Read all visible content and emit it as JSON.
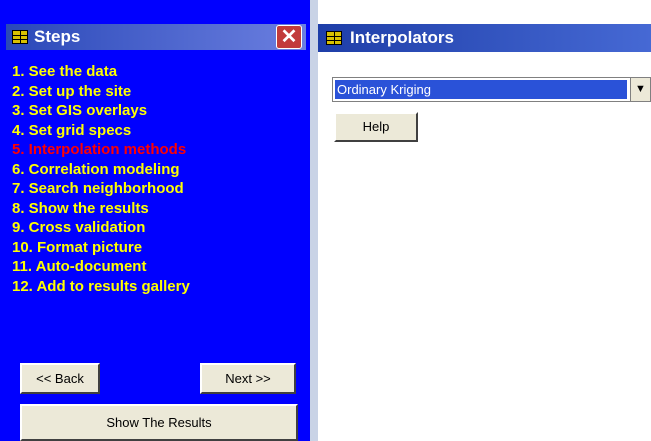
{
  "steps_panel": {
    "title": "Steps",
    "close_label": "✕",
    "items": [
      {
        "label": "1.  See the data",
        "active": false
      },
      {
        "label": "2.  Set up the site",
        "active": false
      },
      {
        "label": "3.  Set GIS overlays",
        "active": false
      },
      {
        "label": "4.  Set grid specs",
        "active": false
      },
      {
        "label": "5.  Interpolation methods",
        "active": true
      },
      {
        "label": "6.  Correlation modeling",
        "active": false
      },
      {
        "label": "7.  Search neighborhood",
        "active": false
      },
      {
        "label": "8.  Show the results",
        "active": false
      },
      {
        "label": "9.  Cross validation",
        "active": false
      },
      {
        "label": "10.  Format picture",
        "active": false
      },
      {
        "label": "11.  Auto-document",
        "active": false
      },
      {
        "label": "12.  Add to results gallery",
        "active": false
      }
    ],
    "back_label": "<< Back",
    "next_label": "Next >>",
    "show_results_label": "Show The Results"
  },
  "interpolators_panel": {
    "title": "Interpolators",
    "method_value": "Ordinary Kriging",
    "help_label": "Help"
  },
  "colors": {
    "panel_bg": "#0000ff",
    "step_text": "#ffff00",
    "active_step_text": "#ff0000"
  }
}
